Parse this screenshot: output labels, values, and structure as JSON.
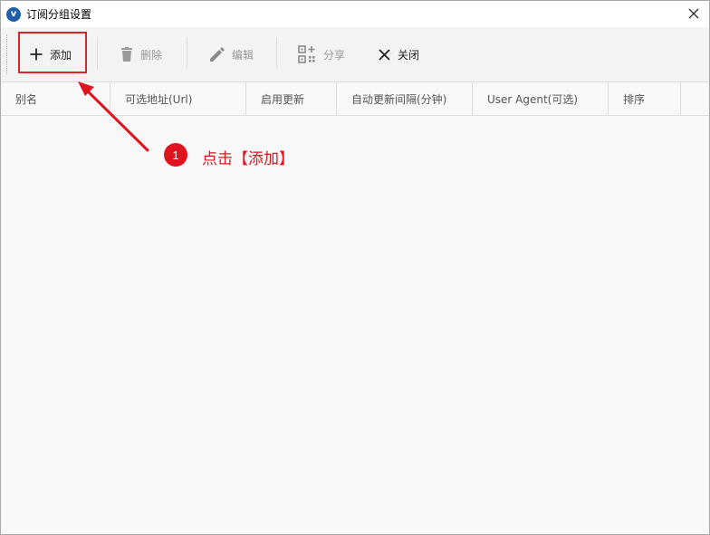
{
  "window": {
    "title": "订阅分组设置",
    "app_icon_letter": "v"
  },
  "toolbar": {
    "add_label": "添加",
    "delete_label": "删除",
    "edit_label": "编辑",
    "share_label": "分享",
    "close_label": "关闭"
  },
  "table": {
    "columns": [
      "别名",
      "可选地址(Url)",
      "启用更新",
      "自动更新间隔(分钟)",
      "User Agent(可选)",
      "排序"
    ],
    "rows": []
  },
  "annotation": {
    "step_number": "1",
    "text": "点击【添加】",
    "color": "#e0141f"
  },
  "colors": {
    "highlight": "#d8262d",
    "app_icon": "#1f5fa8"
  }
}
